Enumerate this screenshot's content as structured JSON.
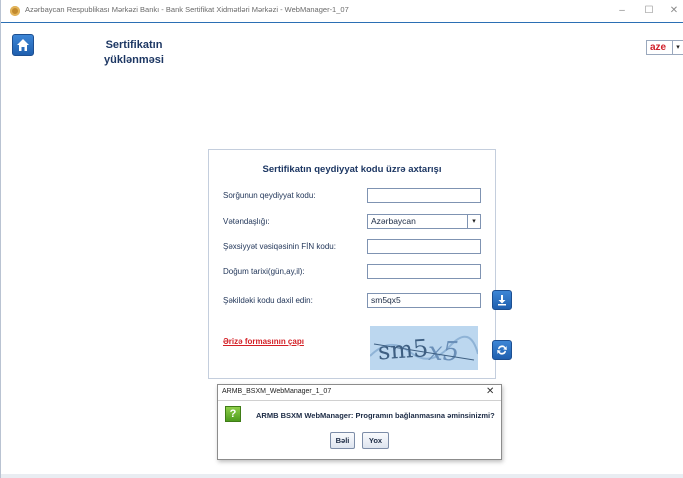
{
  "window": {
    "title": "Azərbaycan Respublikası Mərkəzi Bankı - Bank Sertifikat Xidmətləri Mərkəzi - WebManager-1_07",
    "minimize": "–",
    "maximize": "☐",
    "close": "✕"
  },
  "header": {
    "title_line1": "Sertifikatın",
    "title_line2": "yüklənməsi",
    "language": "aze",
    "lang_arrow": "▾"
  },
  "form": {
    "title": "Sertifikatın qeydiyyat kodu üzrə axtarışı",
    "fields": [
      {
        "label": "Sorğunun qeydiyyat kodu:",
        "value": ""
      },
      {
        "label": "Vətəndaşlığı:",
        "value": "Azərbaycan"
      },
      {
        "label": "Şəxsiyyət vəsiqəsinin FİN kodu:",
        "value": ""
      },
      {
        "label": "Doğum tarixi(gün,ay,il):",
        "value": ""
      },
      {
        "label": "Şəkildəki kodu daxil edin:",
        "value": "sm5qx5"
      }
    ],
    "select_arrow": "▾",
    "print_link": "Ərizə formasının çapı"
  },
  "dialog": {
    "title": "ARMB_BSXM_WebManager_1_07",
    "close": "✕",
    "icon": "?",
    "message": "ARMB BSXM WebManager: Programın bağlanmasına əminsinizmi?",
    "yes": "Bəli",
    "no": "Yox"
  },
  "colors": {
    "accent": "#2b6fb4",
    "link": "#d31f25",
    "title_text": "#1d3763"
  },
  "icons": [
    "app-icon",
    "home-icon",
    "download-icon",
    "refresh-icon",
    "question-icon"
  ]
}
